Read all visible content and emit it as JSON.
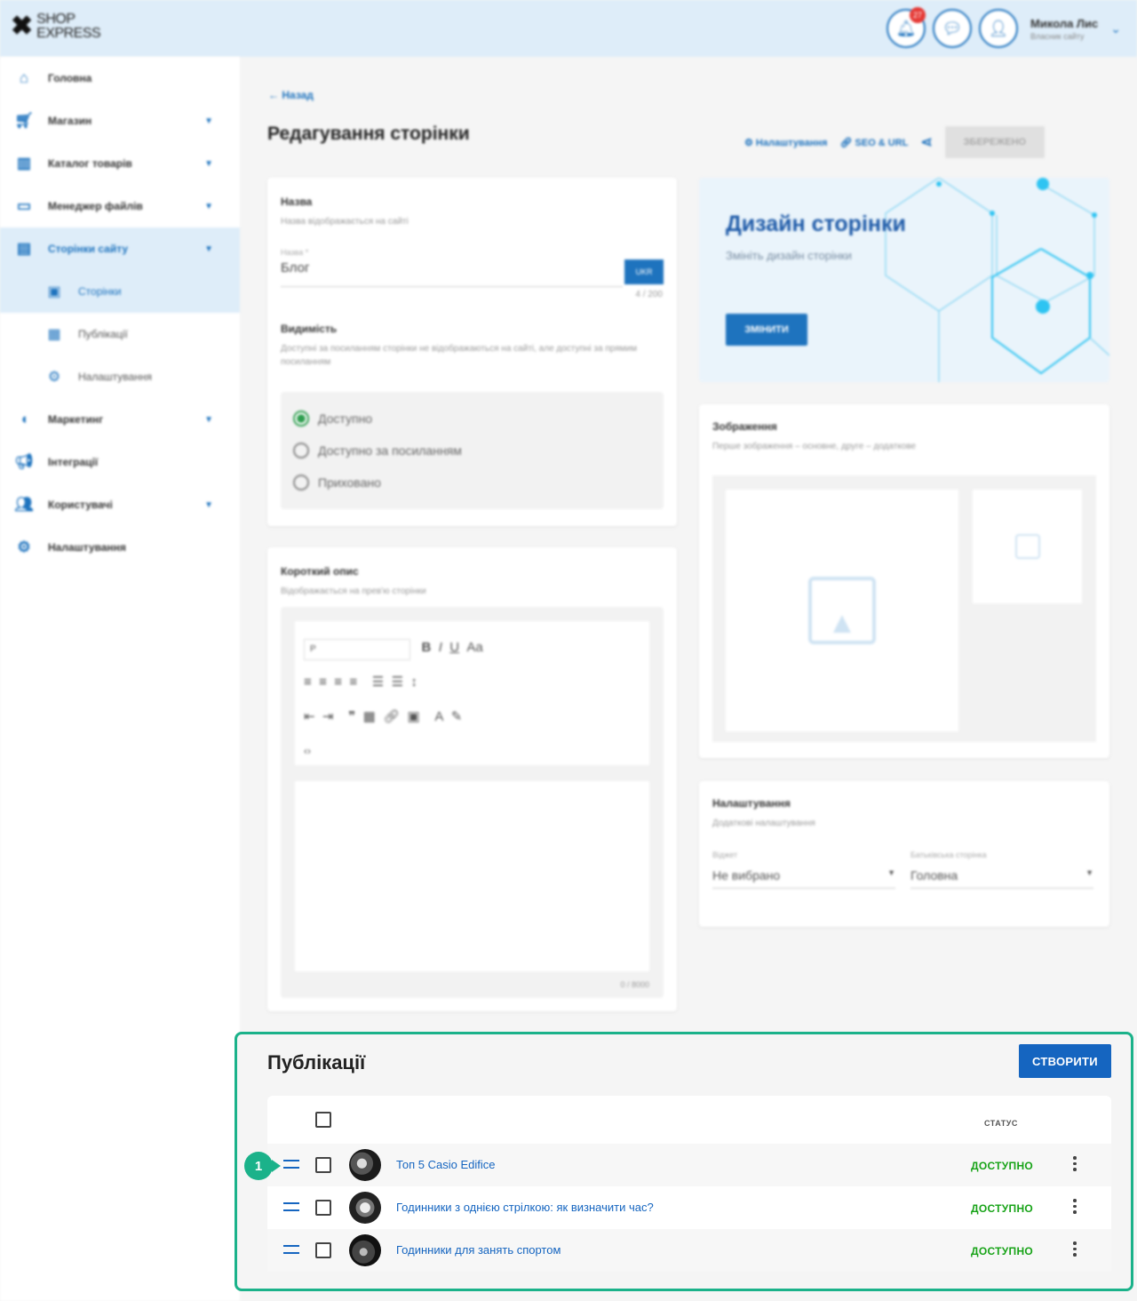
{
  "brand": {
    "logo_line1": "SHOP",
    "logo_line2": "EXPRESS"
  },
  "header": {
    "notifications_count": "27",
    "user_name": "Микола Лис",
    "user_role": "Власник сайту"
  },
  "sidebar": {
    "items": [
      {
        "label": "Головна"
      },
      {
        "label": "Магазин"
      },
      {
        "label": "Каталог товарів"
      },
      {
        "label": "Менеджер файлів"
      },
      {
        "label": "Сторінки сайту"
      },
      {
        "label": "Маркетинг"
      },
      {
        "label": "Інтеграції"
      },
      {
        "label": "Користувачі"
      },
      {
        "label": "Налаштування"
      }
    ],
    "subitems": [
      {
        "label": "Сторінки"
      },
      {
        "label": "Публікації"
      },
      {
        "label": "Налаштування"
      }
    ]
  },
  "page": {
    "back_label": "Назад",
    "title": "Редагування сторінки",
    "actions": {
      "settings": "Налаштування",
      "seo": "SEO & URL",
      "saved": "ЗБЕРЕЖЕНО"
    }
  },
  "name_card": {
    "title": "Назва",
    "subtitle": "Назва відображається на сайті",
    "field_label": "Назва *",
    "field_value": "Блог",
    "lang": "UKR",
    "counter": "4 / 200"
  },
  "visibility": {
    "title": "Видимість",
    "subtitle": "Доступні за посиланням сторінки не відображаються на сайті, але доступні за прямим посиланням",
    "options": [
      "Доступно",
      "Доступно за посиланням",
      "Приховано"
    ],
    "selected": 0
  },
  "short_desc": {
    "title": "Короткий опис",
    "subtitle": "Відображається на прев'ю сторінки",
    "format_select": "P",
    "counter": "0 / 8000"
  },
  "design_card": {
    "title": "Дизайн сторінки",
    "subtitle": "Змініть дизайн сторінки",
    "button": "ЗМІНИТИ"
  },
  "images_card": {
    "title": "Зображення",
    "subtitle": "Перше зображення – основне, друге – додаткове"
  },
  "settings_card": {
    "title": "Налаштування",
    "subtitle": "Додаткові налаштування",
    "widget_label": "Віджет",
    "widget_value": "Не вибрано",
    "parent_label": "Батьківська сторінка",
    "parent_value": "Головна"
  },
  "publications": {
    "title": "Публікації",
    "create_button": "СТВОРИТИ",
    "status_header": "СТАТУС",
    "rows": [
      {
        "title": "Топ 5 Casio Edifice",
        "status": "ДОСТУПНО"
      },
      {
        "title": "Годинники з однією стрілкою: як визначити час?",
        "status": "ДОСТУПНО"
      },
      {
        "title": "Годинники для занять спортом",
        "status": "ДОСТУПНО"
      }
    ],
    "step_marker": "1"
  }
}
